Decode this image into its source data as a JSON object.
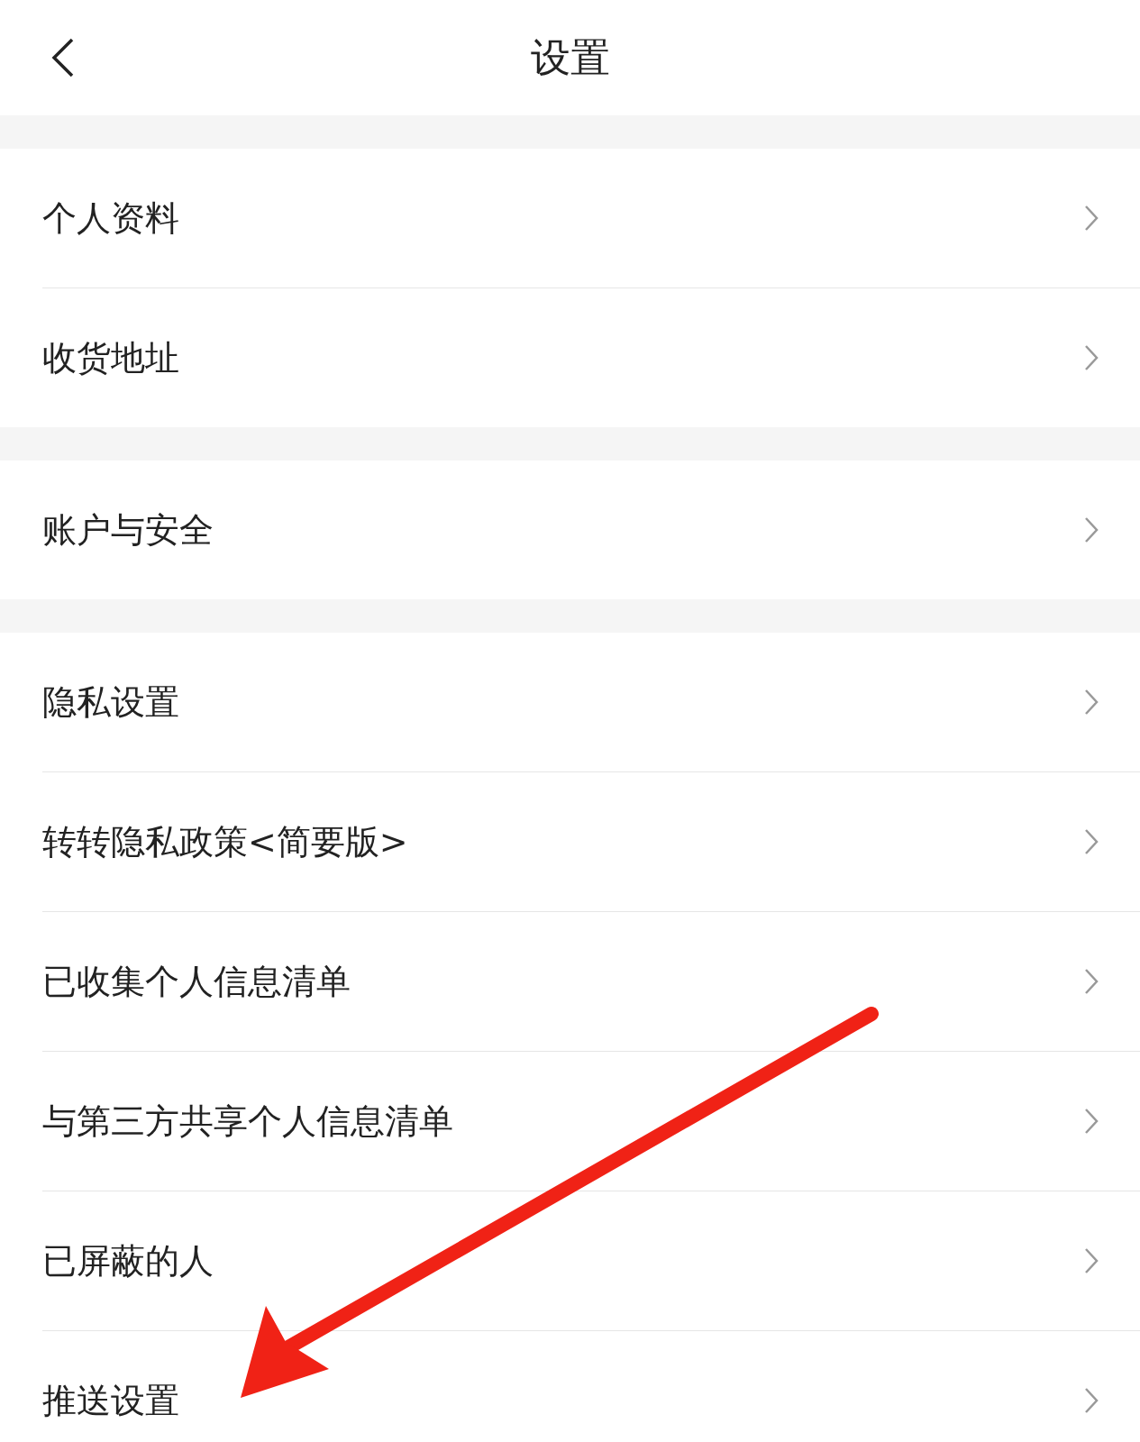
{
  "header": {
    "title": "设置"
  },
  "groups": [
    {
      "items": [
        {
          "label": "个人资料"
        },
        {
          "label": "收货地址"
        }
      ]
    },
    {
      "items": [
        {
          "label": "账户与安全"
        }
      ]
    },
    {
      "items": [
        {
          "label": "隐私设置"
        },
        {
          "label": "转转隐私政策<简要版>"
        },
        {
          "label": "已收集个人信息清单"
        },
        {
          "label": "与第三方共享个人信息清单"
        },
        {
          "label": "已屏蔽的人"
        },
        {
          "label": "推送设置"
        }
      ]
    }
  ]
}
